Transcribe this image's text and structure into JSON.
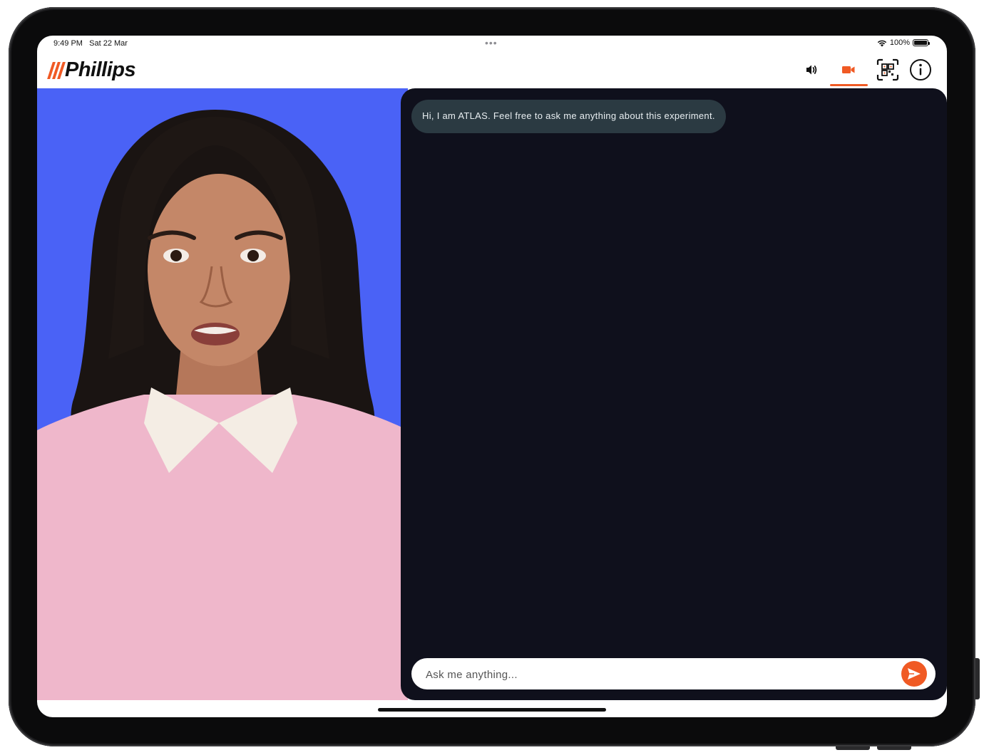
{
  "status_bar": {
    "time": "9:49 PM",
    "date": "Sat 22 Mar",
    "battery": "100%"
  },
  "header": {
    "logo": "Phillips",
    "icons": [
      "speaker-icon",
      "video-camera-icon",
      "qr-code-scan-icon",
      "info-icon"
    ],
    "accent_color": "#f05a24"
  },
  "avatar": {
    "background_color": "#4a62f6"
  },
  "chat": {
    "messages": [
      {
        "from": "assistant",
        "text": "Hi, I am ATLAS. Feel free to ask me anything about this experiment."
      }
    ],
    "input": {
      "placeholder": "Ask me anything...",
      "value": ""
    },
    "background_color": "#0f101c"
  }
}
